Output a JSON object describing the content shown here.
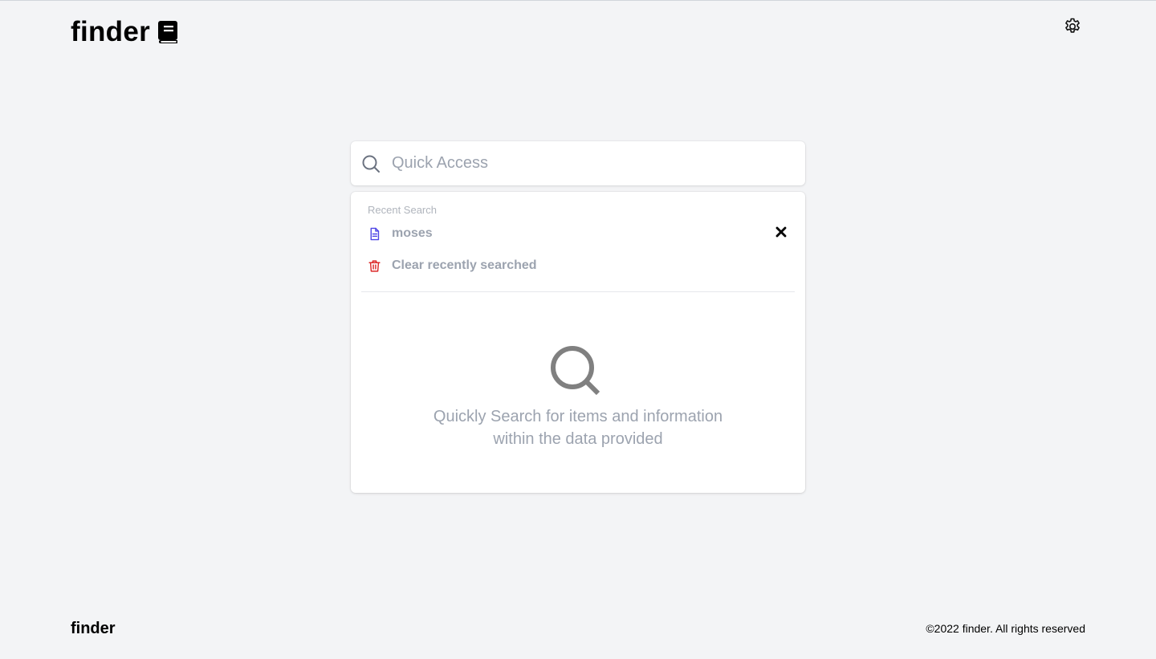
{
  "header": {
    "brand": "finder",
    "logo_icon": "book-icon",
    "settings_icon": "gear-icon"
  },
  "search": {
    "placeholder": "Quick Access",
    "value": "",
    "icon": "search-icon"
  },
  "recent": {
    "heading": "Recent Search",
    "items": [
      {
        "label": "moses",
        "icon": "document-icon",
        "icon_color": "#4f46e5",
        "remove_icon": "close-icon"
      }
    ],
    "clear": {
      "label": "Clear recently searched",
      "icon": "trash-icon",
      "icon_color": "#dc2626"
    }
  },
  "empty_state": {
    "icon": "search-icon",
    "line1": "Quickly Search for items and information",
    "line2": "within the data provided"
  },
  "footer": {
    "brand": "finder",
    "copyright": "©2022 finder. All rights reserved"
  },
  "colors": {
    "background": "#f3f4f6",
    "muted_text": "#9ca3af",
    "accent": "#4f46e5",
    "danger": "#dc2626"
  }
}
